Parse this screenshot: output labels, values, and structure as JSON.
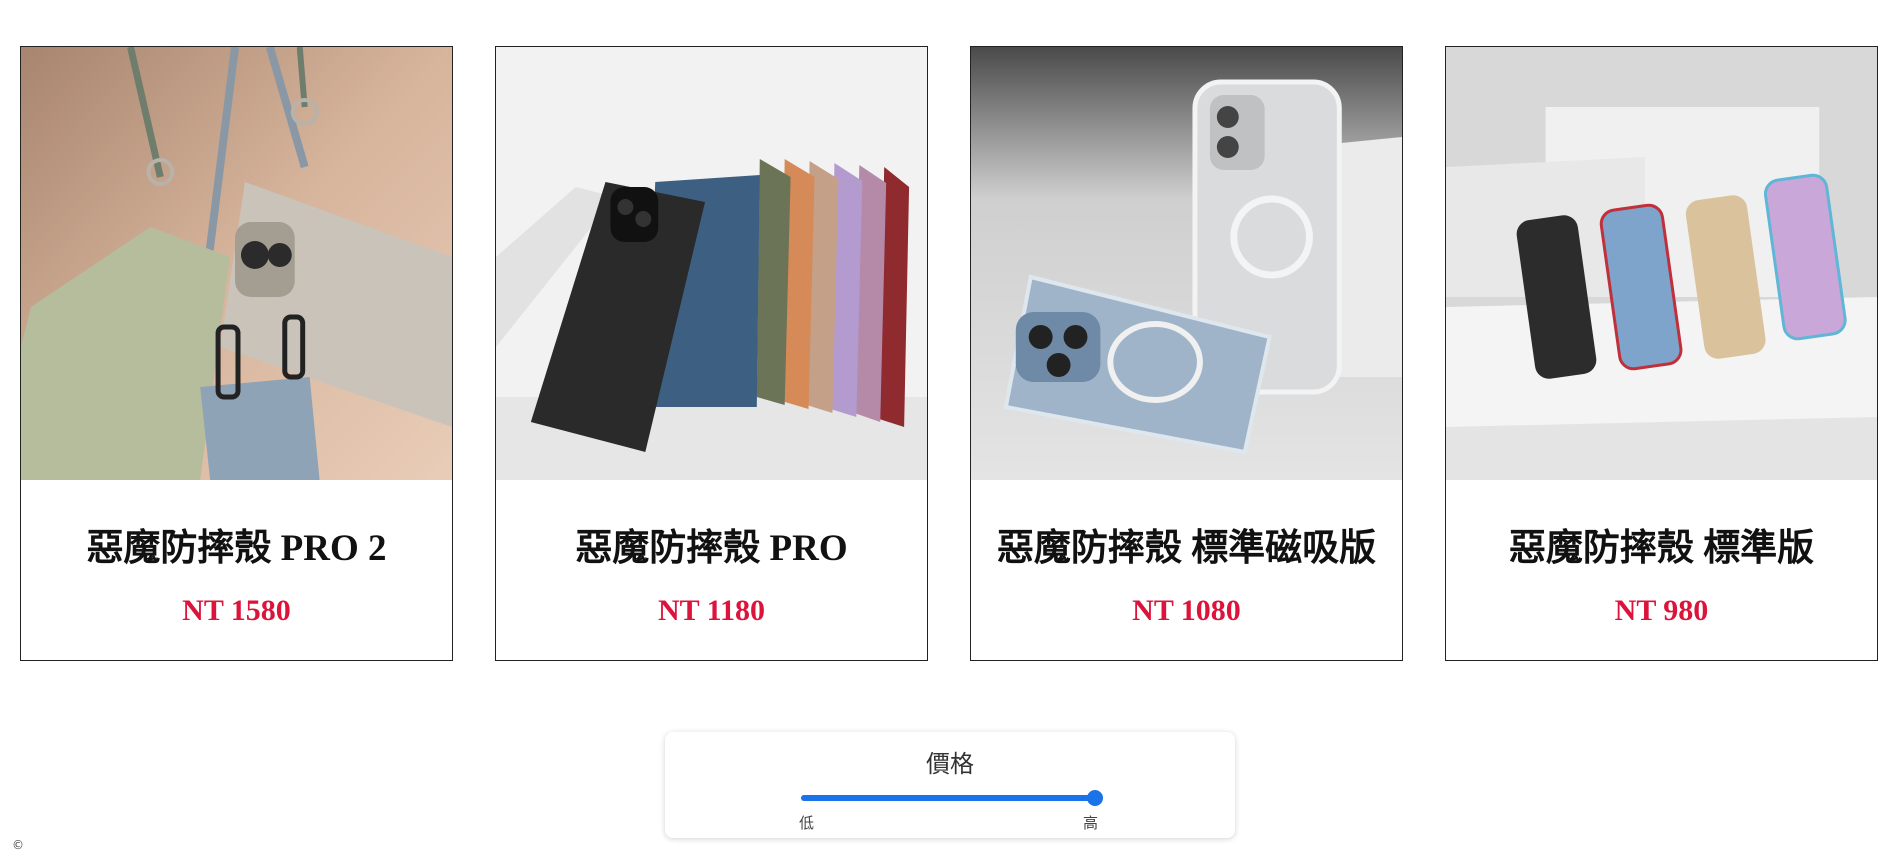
{
  "colors": {
    "price": "#dc143c",
    "slider_accent": "#1a73e8"
  },
  "products": [
    {
      "name": "惡魔防摔殼 PRO 2",
      "price": "NT 1580",
      "image_icon": "phone-case-strap-image"
    },
    {
      "name": "惡魔防摔殼 PRO",
      "price": "NT 1180",
      "image_icon": "phone-case-colors-image"
    },
    {
      "name": "惡魔防摔殼 標準磁吸版",
      "price": "NT 1080",
      "image_icon": "phone-case-magsafe-image"
    },
    {
      "name": "惡魔防摔殼 標準版",
      "price": "NT 980",
      "image_icon": "phone-case-standard-image"
    }
  ],
  "filter": {
    "title": "價格",
    "low_label": "低",
    "high_label": "高",
    "slider_value": 1.0
  }
}
